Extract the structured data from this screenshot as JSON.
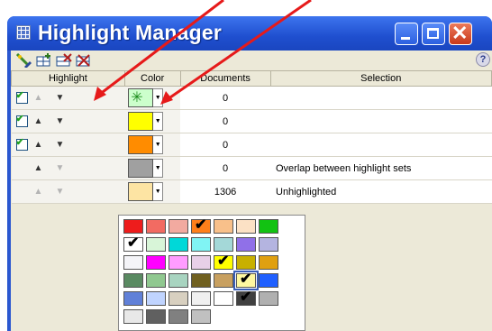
{
  "window": {
    "title": "Highlight Manager"
  },
  "toolbar": {
    "tools": [
      {
        "icon": "new-highlight-icon",
        "color": "#3a8a2a"
      },
      {
        "icon": "add-rows-icon",
        "color": "#2f7a1f"
      },
      {
        "icon": "delete-highlight-icon",
        "color": "#b21d1d"
      },
      {
        "icon": "delete-all-icon",
        "color": "#b21d1d"
      }
    ],
    "help_label": "?"
  },
  "table": {
    "columns": [
      "Highlight",
      "Color",
      "Documents",
      "Selection"
    ],
    "rows": [
      {
        "checked": true,
        "up_enabled": false,
        "down_enabled": true,
        "color": "#ffffff",
        "pattern": true,
        "documents": "0",
        "selection": ""
      },
      {
        "checked": true,
        "up_enabled": true,
        "down_enabled": true,
        "color": "#ffff00",
        "documents": "0",
        "selection": ""
      },
      {
        "checked": true,
        "up_enabled": true,
        "down_enabled": true,
        "color": "#ff8c00",
        "documents": "0",
        "selection": ""
      },
      {
        "checked": null,
        "up_enabled": true,
        "down_enabled": false,
        "color": "#a0a0a0",
        "documents": "0",
        "selection": "Overlap between highlight sets"
      },
      {
        "checked": null,
        "up_enabled": false,
        "down_enabled": false,
        "color": "#fde4a3",
        "documents": "1306",
        "selection": "Unhighlighted"
      }
    ]
  },
  "palette": {
    "rows": [
      [
        "#ee1c1c",
        "#f26b62",
        "#f2aaa0",
        "#ff7f1a",
        "#f8c08a",
        "#fce1c5",
        "#12c212"
      ],
      [
        "#ffffff",
        "#d8f5d8",
        "#00d8d8",
        "#80f4f4",
        "#a4d8d8",
        "#9070e8",
        "#b4b4e0"
      ],
      [
        "#f4f4f8",
        "#ff00ff",
        "#ff9cff",
        "#e8d0e8",
        "#ffff00",
        "#c8b000",
        "#e0a010"
      ],
      [
        "#5a8a62",
        "#90c890",
        "#a8d4c0",
        "#706020",
        "#c8a060",
        "#fff8a0",
        "#2060ff"
      ],
      [
        "#6080d8",
        "#c0d4ff",
        "#d8d0c0",
        "#f0f0f0",
        "#ffffff",
        "#404040",
        "#b0b0b0"
      ],
      [
        "#e8e8e8",
        "#606060",
        "#808080",
        "#c0c0c0"
      ]
    ],
    "checked": [
      [
        0,
        3
      ],
      [
        1,
        0
      ],
      [
        2,
        4
      ],
      [
        3,
        5
      ],
      [
        4,
        5
      ]
    ],
    "selected": [
      3,
      5
    ]
  },
  "annotation": {
    "arrow_color": "#e61a1a"
  }
}
